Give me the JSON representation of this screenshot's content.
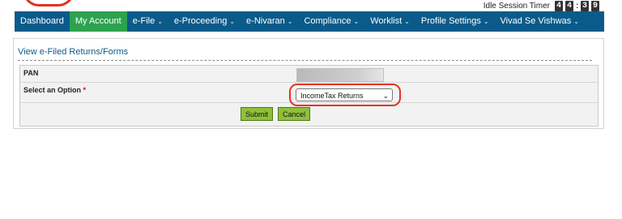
{
  "idle_timer": {
    "label": "Idle Session Timer",
    "digits": [
      "4",
      "4",
      "3",
      "9"
    ]
  },
  "nav": {
    "items": [
      {
        "label": "Dashboard",
        "dropdown": false
      },
      {
        "label": "My Account",
        "dropdown": false,
        "active": true
      },
      {
        "label": "e-File",
        "dropdown": true
      },
      {
        "label": "e-Proceeding",
        "dropdown": true
      },
      {
        "label": "e-Nivaran",
        "dropdown": true
      },
      {
        "label": "Compliance",
        "dropdown": true
      },
      {
        "label": "Worklist",
        "dropdown": true
      },
      {
        "label": "Profile Settings",
        "dropdown": true
      },
      {
        "label": "Vivad Se Vishwas",
        "dropdown": true
      }
    ]
  },
  "panel": {
    "title": "View e-Filed Returns/Forms",
    "pan_label": "PAN",
    "option_label": "Select an Option",
    "required_marker": "*",
    "option_value": "IncomeTax Returns",
    "submit_label": "Submit",
    "cancel_label": "Cancel"
  },
  "colors": {
    "nav_bg": "#0b5b8a",
    "active_tab": "#2da24f",
    "highlight": "#e8321f",
    "button": "#8fbf3a"
  }
}
